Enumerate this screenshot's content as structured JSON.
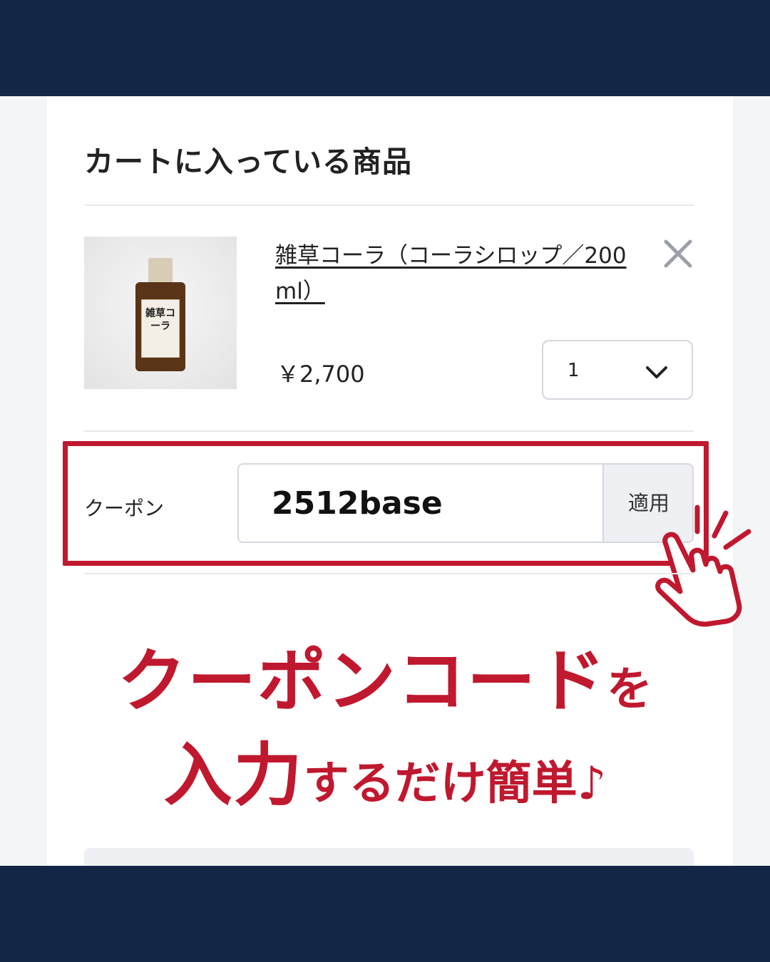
{
  "cart": {
    "title": "カートに入っている商品",
    "item": {
      "name": "雑草コーラ（コーラシロップ／200ml）",
      "image_label": "雑草コーラ",
      "price": "￥2,700",
      "quantity": "1",
      "remove_icon": "close-icon",
      "quantity_icon": "chevron-down-icon"
    }
  },
  "coupon": {
    "label": "クーポン",
    "code": "2512base",
    "apply_label": "適用"
  },
  "promo": {
    "line1_main": "クーポンコード",
    "line1_tail": "を",
    "line2_main": "入力",
    "line2_tail": "するだけ簡単♪"
  },
  "colors": {
    "navy": "#132645",
    "accent_red": "#c0182e"
  }
}
